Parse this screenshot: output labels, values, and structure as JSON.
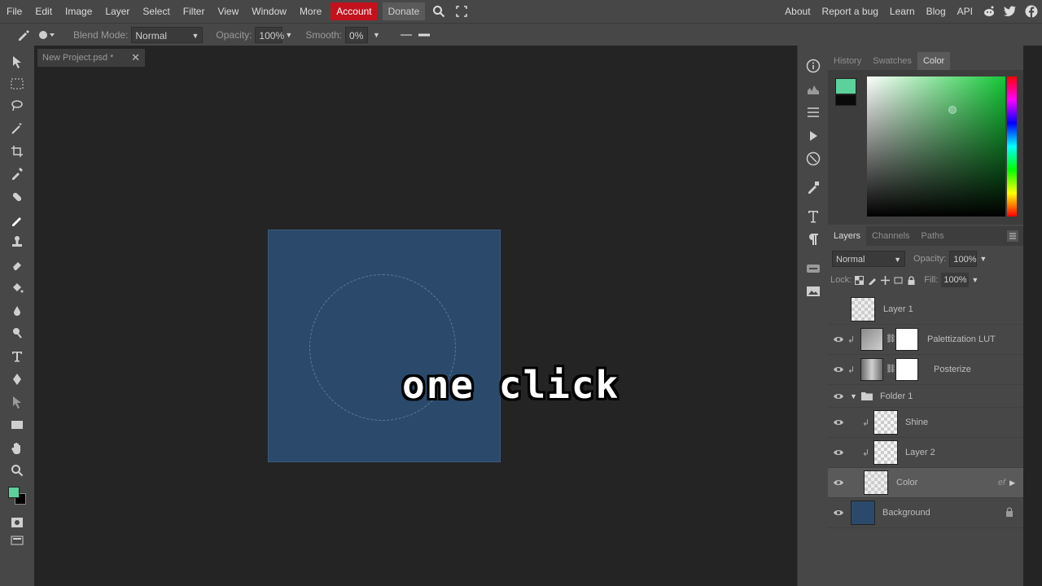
{
  "menu": {
    "items": [
      "File",
      "Edit",
      "Image",
      "Layer",
      "Select",
      "Filter",
      "View",
      "Window",
      "More"
    ],
    "account": "Account",
    "donate": "Donate",
    "right_links": [
      "About",
      "Report a bug",
      "Learn",
      "Blog",
      "API"
    ]
  },
  "options": {
    "blend_label": "Blend Mode:",
    "blend_value": "Normal",
    "opacity_label": "Opacity:",
    "opacity_value": "100%",
    "smooth_label": "Smooth:",
    "smooth_value": "0%"
  },
  "document": {
    "tab_title": "New Project.psd *",
    "canvas_color": "#2b4a6b"
  },
  "caption": "one click",
  "color_panel": {
    "tabs": [
      "History",
      "Swatches",
      "Color"
    ],
    "active_tab": "Color",
    "foreground": "#5cd19b",
    "background": "#0a0a0a"
  },
  "layers_panel": {
    "tabs": [
      "Layers",
      "Channels",
      "Paths"
    ],
    "active_tab": "Layers",
    "blend_value": "Normal",
    "opacity_label": "Opacity:",
    "opacity_value": "100%",
    "lock_label": "Lock:",
    "fill_label": "Fill:",
    "fill_value": "100%",
    "layers": [
      {
        "name": "Layer 1"
      },
      {
        "name": "Palettization LUT"
      },
      {
        "name": "Posterize"
      },
      {
        "name": "Folder 1"
      },
      {
        "name": "Shine"
      },
      {
        "name": "Layer 2"
      },
      {
        "name": "Color",
        "fx": "ef"
      },
      {
        "name": "Background"
      }
    ]
  }
}
